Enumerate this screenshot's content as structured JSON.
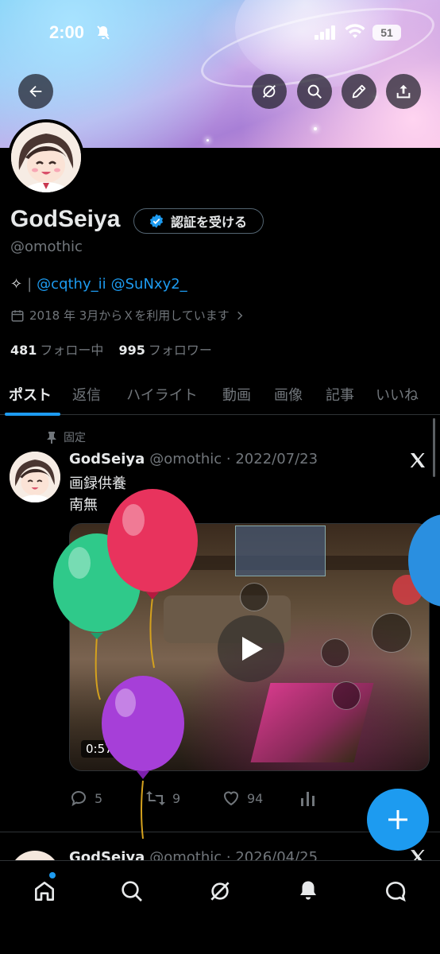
{
  "status_bar": {
    "time": "2:00",
    "battery": "51"
  },
  "profile": {
    "name": "GodSeiya",
    "verify_label": "認証を受ける",
    "handle": "@omothic",
    "bio_symbol": "✧",
    "bio_separator": "|",
    "bio_mention_1": "@cqthy_ii",
    "bio_mention_2": "@SuNxy2_",
    "joined": "2018 年 3月からＸを利用しています",
    "following_count": "481",
    "following_label": "フォロー中",
    "followers_count": "995",
    "followers_label": "フォロワー"
  },
  "tabs": [
    "ポスト",
    "返信",
    "ハイライト",
    "動画",
    "画像",
    "記事",
    "いいね"
  ],
  "pinned_post": {
    "pinned_label": "固定",
    "author": "GodSeiya",
    "handle_date": "@omothic · 2022/07/23",
    "line1": "画録供養",
    "line2": "南無",
    "video_duration": "0:57",
    "replies": "5",
    "reposts": "9",
    "likes": "94"
  },
  "next_post": {
    "author": "GodSeiya",
    "handle_date": "@omothic · 2026/04/25"
  },
  "colors": {
    "accent": "#1d9bf0",
    "background": "#000000",
    "muted": "#71767b",
    "text": "#e7e9ea",
    "balloon_green": "#2fc98a",
    "balloon_red": "#e8335d",
    "balloon_purple": "#a63fd8",
    "balloon_blue": "#2a8fe0"
  },
  "icons": {
    "back": "arrow-left-icon",
    "grok": "grok-icon",
    "search": "search-icon",
    "edit": "pencil-icon",
    "share": "share-icon",
    "home": "home-icon",
    "notifications": "bell-icon",
    "messages": "message-icon",
    "compose": "plus-icon"
  }
}
